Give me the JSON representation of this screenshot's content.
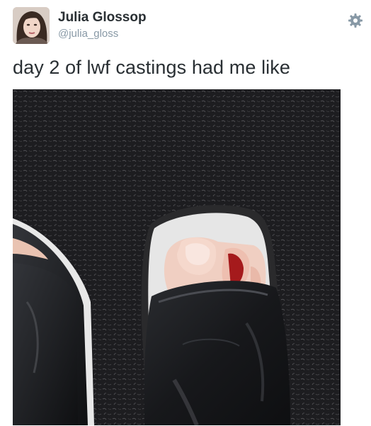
{
  "tweet": {
    "author": {
      "display_name": "Julia Glossop",
      "handle": "@julia_gloss",
      "avatar": "profile-photo"
    },
    "menu_icon": "gear-icon",
    "text": "day 2 of lwf castings had me like",
    "media": {
      "type": "photo",
      "subject": "open-toe black heels on dark carpet"
    }
  }
}
